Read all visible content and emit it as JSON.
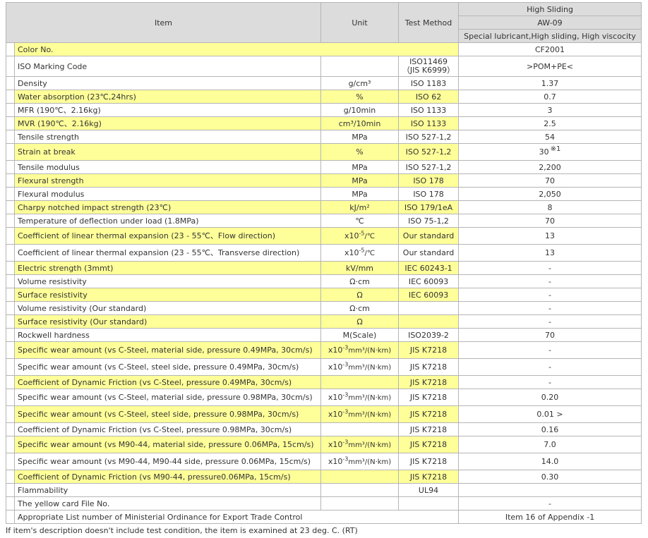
{
  "header": {
    "item": "Item",
    "unit": "Unit",
    "method": "Test Method",
    "grade_line1": "High Sliding",
    "grade_line2": "AW-09",
    "grade_line3": "Special lubricant,High sliding, High viscocity"
  },
  "colors": {
    "highlight": "#ffff99",
    "header": "#dcdcdc",
    "border": "#b5b5b5"
  },
  "rows": [
    {
      "item": "Color No.",
      "value": "CF2001",
      "hl": true,
      "span": true,
      "h": 19
    },
    {
      "item": "ISO Marking Code",
      "method": "ISO11469",
      "method2": "（JIS K6999）",
      "value": ">POM+PE<",
      "hl": false,
      "h": 29
    },
    {
      "item": "Density",
      "unit": "g/cm³",
      "method": "ISO 1183",
      "value": "1.37",
      "hl": false,
      "h": 19
    },
    {
      "item": "Water absorption (23℃,24hrs)",
      "unit": "%",
      "method": "ISO 62",
      "value": "0.7",
      "hl": true,
      "h": 19
    },
    {
      "item": "MFR (190℃、2.16kg)",
      "unit": "g/10min",
      "method": "ISO 1133",
      "value": "3",
      "hl": false,
      "h": 19
    },
    {
      "item": "MVR (190℃、2.16kg)",
      "unit": "cm³/10min",
      "method": "ISO 1133",
      "value": "2.5",
      "hl": true,
      "h": 19
    },
    {
      "item": "Tensile strength",
      "unit": "MPa",
      "method": "ISO 527-1,2",
      "value": "54",
      "hl": false,
      "h": 19
    },
    {
      "item": "Strain at break",
      "unit": "%",
      "method": "ISO 527-1,2",
      "value": "30",
      "note": "※1",
      "hl": true,
      "h": 24
    },
    {
      "item": "Tensile modulus",
      "unit": "MPa",
      "method": "ISO 527-1,2",
      "value": "2,200",
      "hl": false,
      "h": 19
    },
    {
      "item": "Flexural strength",
      "unit": "MPa",
      "method": "ISO 178",
      "value": "70",
      "hl": true,
      "h": 19
    },
    {
      "item": "Flexural modulus",
      "unit": "MPa",
      "method": "ISO 178",
      "value": "2,050",
      "hl": false,
      "h": 19
    },
    {
      "item": "Charpy notched impact strength (23℃)",
      "unit": "kJ/m²",
      "method": "ISO 179/1eA",
      "value": "8",
      "hl": true,
      "h": 19
    },
    {
      "item": "Temperature of deflection under load (1.8MPa)",
      "unit": "℃",
      "method": "ISO 75-1,2",
      "value": "70",
      "hl": false,
      "h": 19
    },
    {
      "item": "Coefficient of linear thermal expansion (23 - 55℃、Flow direction)",
      "unit_pre": "x10",
      "unit_exp": "-5",
      "unit_post": "/℃",
      "method": "Our standard",
      "value": "13",
      "hl": true,
      "h": 24
    },
    {
      "item": "Coefficient of linear thermal expansion (23 - 55℃、Transverse direction)",
      "unit_pre": "x10",
      "unit_exp": "-5",
      "unit_post": "/℃",
      "method": "Our standard",
      "value": "13",
      "hl": false,
      "h": 24
    },
    {
      "item": "Electric strength (3mmt)",
      "unit": "kV/mm",
      "method": "IEC 60243-1",
      "value": "-",
      "hl": true,
      "h": 19
    },
    {
      "item": "Volume resistivity",
      "unit": "Ω·cm",
      "method": "IEC 60093",
      "value": "-",
      "hl": false,
      "h": 19
    },
    {
      "item": "Surface resistivity",
      "unit": "Ω",
      "method": "IEC 60093",
      "value": "-",
      "hl": true,
      "h": 19
    },
    {
      "item": "Volume resistivity (Our standard)",
      "unit": "Ω·cm",
      "method": "",
      "value": "-",
      "hl": false,
      "h": 19
    },
    {
      "item": "Surface resistivity (Our standard)",
      "unit": "Ω",
      "method": "",
      "value": "-",
      "hl": true,
      "h": 19
    },
    {
      "item": "Rockwell hardness",
      "unit": "M(Scale)",
      "method": "ISO2039-2",
      "value": "70",
      "hl": false,
      "h": 19
    },
    {
      "item": "Specific wear amount (vs C-Steel, material side, pressure 0.49MPa, 30cm/s)",
      "unit_pre": "x10",
      "unit_exp": "-3",
      "unit_post": "mm³/(N·km)",
      "method": "JIS K7218",
      "value": "-",
      "hl": true,
      "h": 24
    },
    {
      "item": "Specific wear amount (vs C-Steel, steel side, pressure 0.49MPa, 30cm/s)",
      "unit_pre": "x10",
      "unit_exp": "-3",
      "unit_post": "mm³/(N·km)",
      "method": "JIS K7218",
      "value": "-",
      "hl": false,
      "h": 24
    },
    {
      "item": "Coefficient of Dynamic Friction (vs C-Steel, pressure 0.49MPa, 30cm/s)",
      "unit": "",
      "method": "JIS K7218",
      "value": "-",
      "hl": true,
      "h": 19
    },
    {
      "item": "Specific wear amount (vs C-Steel, material side, pressure 0.98MPa, 30cm/s)",
      "unit_pre": "x10",
      "unit_exp": "-3",
      "unit_post": "mm³/(N·km)",
      "method": "JIS K7218",
      "value": "0.20",
      "hl": false,
      "h": 24
    },
    {
      "item": "Specific wear amount (vs C-Steel, steel side, pressure 0.98MPa, 30cm/s)",
      "unit_pre": "x10",
      "unit_exp": "-3",
      "unit_post": "mm³/(N·km)",
      "method": "JIS K7218",
      "value": "0.01 >",
      "hl": true,
      "h": 24
    },
    {
      "item": "Coefficient of Dynamic Friction (vs C-Steel, pressure 0.98MPa, 30cm/s)",
      "unit": "",
      "method": "JIS K7218",
      "value": "0.16",
      "hl": false,
      "h": 19
    },
    {
      "item": "Specific wear amount (vs M90-44, material side, pressure 0.06MPa, 15cm/s)",
      "unit_pre": "x10",
      "unit_exp": "-3",
      "unit_post": "mm³/(N·km)",
      "method": "JIS K7218",
      "value": "7.0",
      "hl": true,
      "h": 24
    },
    {
      "item": "Specific wear amount (vs M90-44, M90-44 side, pressure 0.06MPa, 15cm/s)",
      "unit_pre": "x10",
      "unit_exp": "-3",
      "unit_post": "mm³/(N·km)",
      "method": "JIS K7218",
      "value": "14.0",
      "hl": false,
      "h": 24
    },
    {
      "item": "Coefficient of Dynamic Friction (vs M90-44, pressure0.06MPa, 15cm/s)",
      "unit": "",
      "method": "JIS K7218",
      "value": "0.30",
      "hl": true,
      "h": 19
    },
    {
      "item": "Flammability",
      "unit": "",
      "method": "UL94",
      "value": "",
      "hl": false,
      "h": 19
    },
    {
      "item": "The yellow card File No.",
      "unit": "",
      "method": "",
      "value": "-",
      "hl": false,
      "h": 19
    },
    {
      "item": "Appropriate List number of Ministerial Ordinance for Export Trade Control",
      "value": "Item 16 of Appendix -1",
      "hl": false,
      "span": true,
      "h": 19
    }
  ],
  "footnote": "If item's description doesn't include test condition, the item is examined at 23 deg. C. (RT)"
}
